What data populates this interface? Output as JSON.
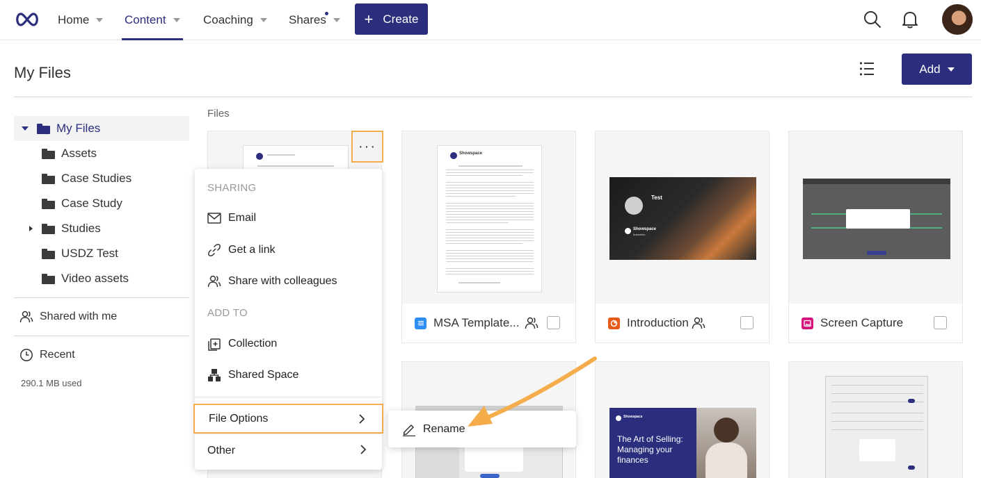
{
  "nav": {
    "items": [
      {
        "label": "Home",
        "active": false,
        "caret": true
      },
      {
        "label": "Content",
        "active": true,
        "caret": true
      },
      {
        "label": "Coaching",
        "active": false,
        "caret": true
      },
      {
        "label": "Shares",
        "active": false,
        "caret": true,
        "dot": true
      }
    ],
    "create_label": "Create"
  },
  "header": {
    "title": "My Files",
    "add_label": "Add"
  },
  "sidebar": {
    "tree": [
      {
        "label": "My Files",
        "selected": true,
        "expanded": true
      },
      {
        "label": "Assets"
      },
      {
        "label": "Case Studies"
      },
      {
        "label": "Case Study"
      },
      {
        "label": "Studies",
        "collapsed": true
      },
      {
        "label": "USDZ Test"
      },
      {
        "label": "Video assets"
      }
    ],
    "shared_with_me": "Shared with me",
    "recent": "Recent",
    "storage": "290.1 MB used"
  },
  "files": {
    "section_label": "Files",
    "cards": [
      {
        "name": "MSA Template...",
        "type": "document",
        "shared": true,
        "badge_color": "#2f8ef5"
      },
      {
        "name": "Introduction",
        "type": "presentation",
        "shared": true,
        "badge_color": "#e8591a"
      },
      {
        "name": "Screen Capture",
        "type": "image",
        "shared": false,
        "badge_color": "#d6157c"
      }
    ],
    "thumb_text": {
      "showspace": "Showspace",
      "industries": "Industries",
      "test": "Test",
      "selling_title": "The Art of Selling: Managing your finances"
    }
  },
  "context_menu": {
    "sharing_header": "SHARING",
    "email": "Email",
    "get_link": "Get a link",
    "share_colleagues": "Share with colleagues",
    "add_to_header": "ADD TO",
    "collection": "Collection",
    "shared_space": "Shared Space",
    "file_options": "File Options",
    "other": "Other"
  },
  "submenu": {
    "rename": "Rename"
  },
  "colors": {
    "brand": "#2a2e7d",
    "highlight": "#f4ad4a"
  }
}
